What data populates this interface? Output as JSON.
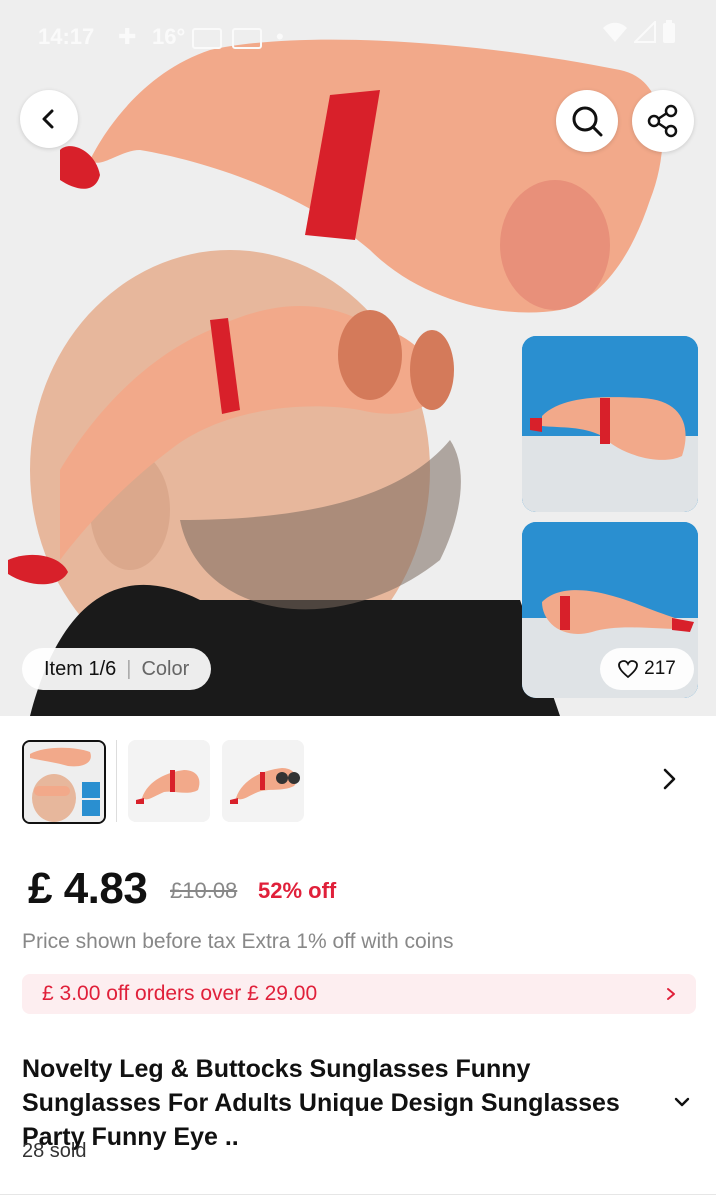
{
  "status_bar": {
    "time": "14:17",
    "temperature": "16°"
  },
  "gallery": {
    "item_label": "Item 1/6",
    "variant_label": "Color",
    "likes": "217"
  },
  "price": {
    "current": "£ 4.83",
    "original": "£10.08",
    "discount": "52% off",
    "tax_note": "Price shown before tax Extra 1% off with coins"
  },
  "coupon": {
    "text": "£ 3.00 off orders over  £ 29.00"
  },
  "product": {
    "title": "Novelty Leg & Buttocks Sunglasses Funny Sunglasses For Adults Unique Design Sunglasses Party Funny Eye ..",
    "sold": "28 sold"
  },
  "colors": {
    "accent": "#e0203a",
    "coupon_bg": "#fdeef0",
    "skin": "#f2a98a",
    "strap": "#d8202a",
    "sky": "#2a8fd0"
  },
  "icons": [
    "back-arrow-icon",
    "search-icon",
    "share-icon",
    "heart-icon",
    "chevron-right-icon",
    "chevron-down-icon"
  ]
}
